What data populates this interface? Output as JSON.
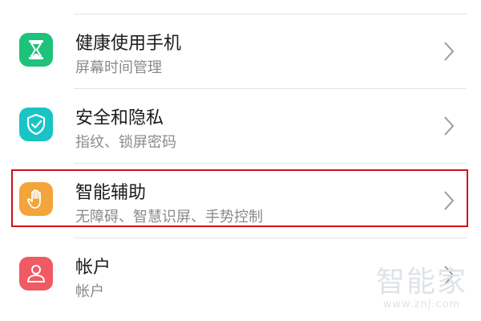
{
  "settings": {
    "items": [
      {
        "title": "健康使用手机",
        "subtitle": "屏幕时间管理",
        "icon": "hourglass-icon",
        "color": "#1fc27a"
      },
      {
        "title": "安全和隐私",
        "subtitle": "指纹、锁屏密码",
        "icon": "shield-check-icon",
        "color": "#19c4c4"
      },
      {
        "title": "智能辅助",
        "subtitle": "无障碍、智慧识屏、手势控制",
        "icon": "hand-icon",
        "color": "#f3a43b"
      },
      {
        "title": "帐户",
        "subtitle": "帐户",
        "icon": "person-icon",
        "color": "#f05a63"
      }
    ]
  },
  "highlight": {
    "color": "#d0101b"
  },
  "watermark": {
    "text": "智能家",
    "url": "www.znj.com"
  }
}
